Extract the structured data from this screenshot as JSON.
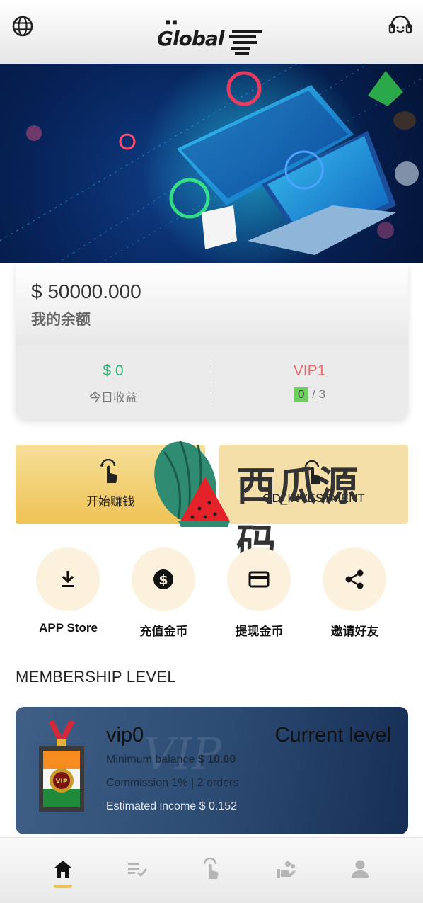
{
  "header": {
    "logo_text": "Global",
    "logo_dots": "■■",
    "language_icon": "globe-icon",
    "support_icon": "headset-icon"
  },
  "banner": {
    "image": "technology-laptop-illustration"
  },
  "balance": {
    "amount": "$ 50000.000",
    "label": "我的余额",
    "today_amount": "$ 0",
    "today_label": "今日收益",
    "vip_name": "VIP1",
    "vip_progress_current": "0",
    "vip_progress_total": "/ 3",
    "colors": {
      "income": "#2bb673",
      "vip": "#e86b6b"
    }
  },
  "actions": {
    "start_label": "开始赚钱",
    "start_icon": "tap-hand-icon",
    "invest_label": "QD_INVESTMENT",
    "invest_icon": "tap-hand-icon"
  },
  "watermark": {
    "text": "西瓜源码",
    "icon": "watermelon-icon"
  },
  "quick_links": [
    {
      "label": "APP Store",
      "icon": "download-icon"
    },
    {
      "label": "充值金币",
      "icon": "dollar-coin-icon"
    },
    {
      "label": "提现金币",
      "icon": "credit-card-icon"
    },
    {
      "label": "邀请好友",
      "icon": "share-icon"
    }
  ],
  "membership": {
    "section_title": "MEMBERSHIP LEVEL",
    "level": "vip0",
    "current_label": "Current level",
    "min_balance_label": "Minimum balance",
    "min_balance_value": "$ 10.00",
    "commission": "Commission 1% | 2 orders",
    "income": "Estimated income $ 0.152",
    "badge_text": "VIP",
    "card_watermark": "VIP"
  },
  "bottom_nav": [
    {
      "icon": "home-icon",
      "active": true
    },
    {
      "icon": "task-list-icon",
      "active": false
    },
    {
      "icon": "tap-hand-icon",
      "active": false
    },
    {
      "icon": "hand-coins-icon",
      "active": false
    },
    {
      "icon": "person-icon",
      "active": false
    }
  ],
  "accent_color": "#f0c350"
}
